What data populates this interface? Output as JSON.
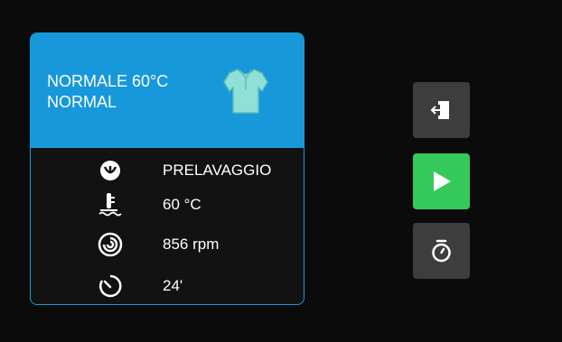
{
  "program": {
    "name_line1": "NORMALE 60°C",
    "name_line2": "NORMAL",
    "icon": "shirt-icon"
  },
  "details": [
    {
      "icon": "prewash-icon",
      "value": "PRELAVAGGIO"
    },
    {
      "icon": "temperature-icon",
      "value": "60 °C"
    },
    {
      "icon": "spin-icon",
      "value": "856 rpm"
    },
    {
      "icon": "timer-icon",
      "value": "24'"
    }
  ],
  "buttons": {
    "exit": "exit-door-icon",
    "start": "play-icon",
    "delay": "stopwatch-icon"
  },
  "colors": {
    "accent": "#1798db",
    "start": "#34c95a",
    "button": "#3d3d3d",
    "background": "#0b0b0b"
  }
}
